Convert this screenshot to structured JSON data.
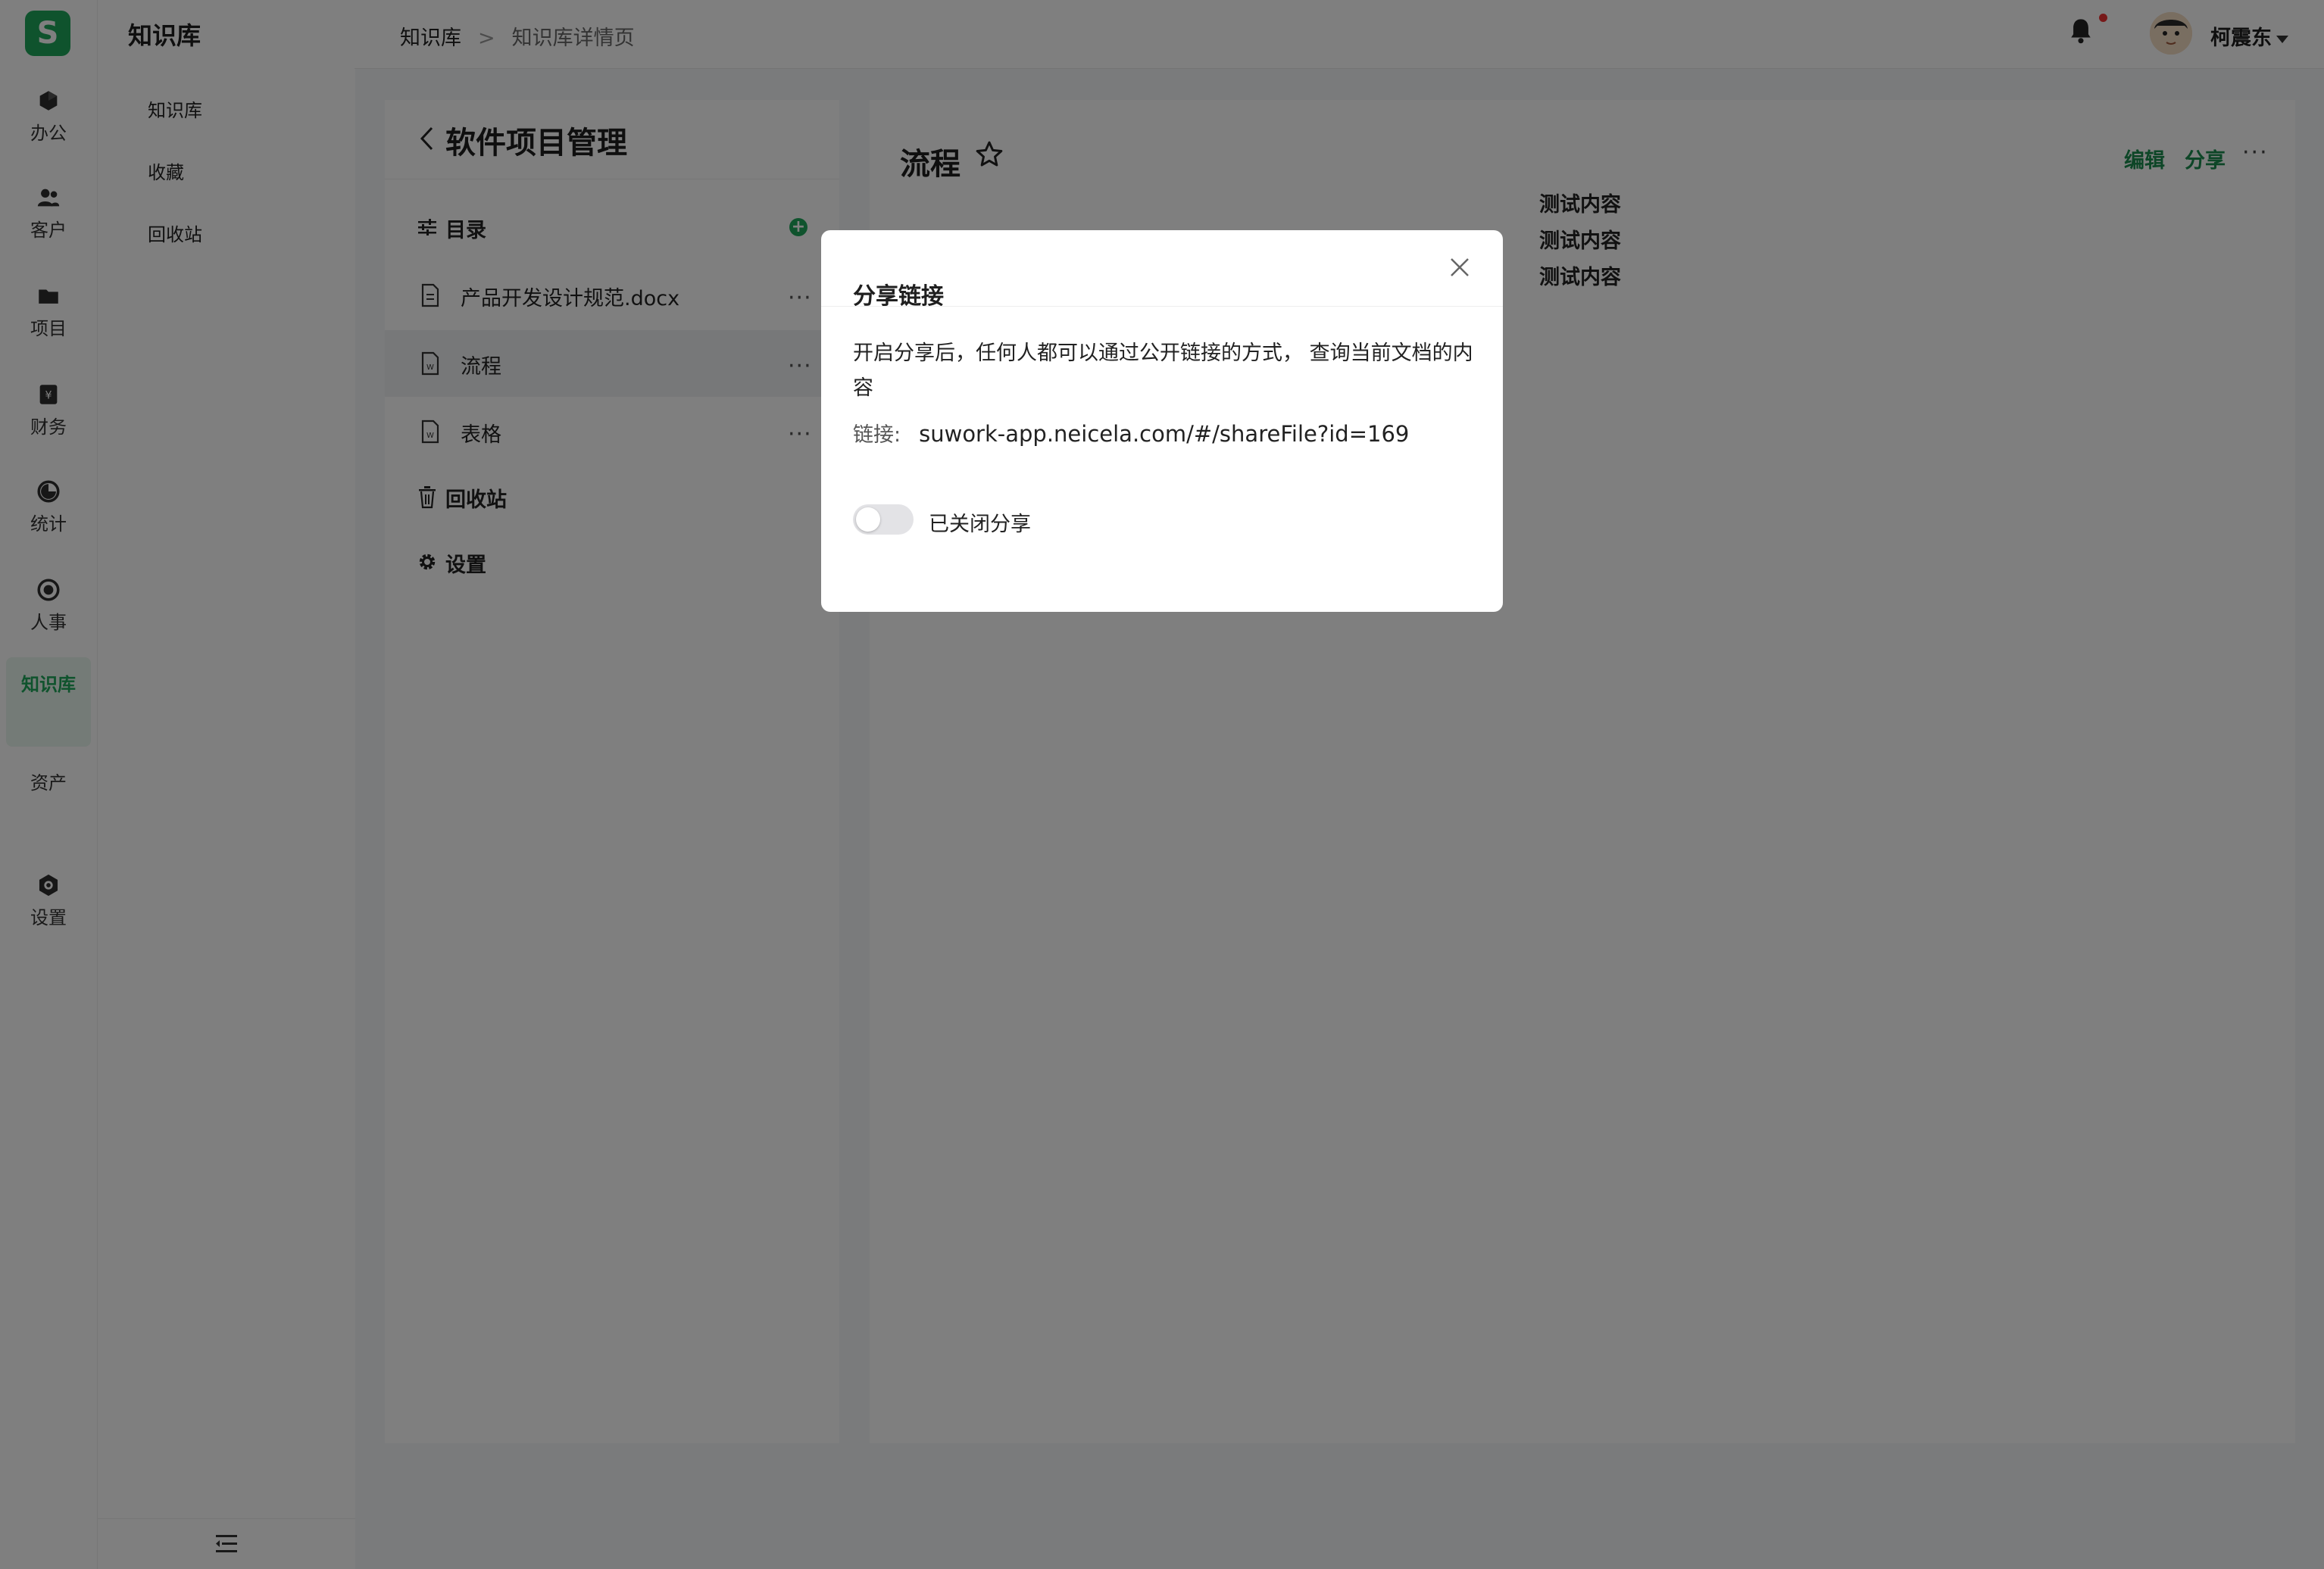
{
  "app": {
    "logo_letter": "S",
    "nav": [
      {
        "label": "办公",
        "icon": "office-icon"
      },
      {
        "label": "客户",
        "icon": "customers-icon"
      },
      {
        "label": "项目",
        "icon": "folder-icon"
      },
      {
        "label": "财务",
        "icon": "finance-icon"
      },
      {
        "label": "统计",
        "icon": "stats-icon"
      },
      {
        "label": "人事",
        "icon": "hr-icon"
      },
      {
        "label": "知识库",
        "icon": "knowledge-icon",
        "active": true
      },
      {
        "label": "资产",
        "icon": "assets-icon"
      },
      {
        "label": "设置",
        "icon": "settings-icon"
      }
    ],
    "accent_color": "#1fa65a"
  },
  "subnav": {
    "title": "知识库",
    "items": [
      "知识库",
      "收藏",
      "回收站"
    ]
  },
  "header": {
    "breadcrumb": [
      "知识库",
      "知识库详情页"
    ],
    "separator": ">",
    "user_name": "柯震东"
  },
  "tree": {
    "title": "软件项目管理",
    "directory_label": "目录",
    "docs": [
      {
        "name": "产品开发设计规范.docx",
        "more": "···"
      },
      {
        "name": "流程",
        "more": "···",
        "selected": true
      },
      {
        "name": "表格",
        "more": "···"
      }
    ],
    "recycle_label": "回收站",
    "settings_label": "设置"
  },
  "content": {
    "title": "流程",
    "edit_label": "编辑",
    "share_label": "分享",
    "more": "···",
    "lines": [
      "测试内容",
      "测试内容",
      "测试内容"
    ]
  },
  "modal": {
    "title": "分享链接",
    "description": "开启分享后，任何人都可以通过公开链接的方式， 查询当前文档的内容",
    "link_label": "链接:",
    "link_value": "suwork-app.neicela.com/#/shareFile?id=169",
    "toggle_label": "已关闭分享",
    "toggle_on": false
  }
}
